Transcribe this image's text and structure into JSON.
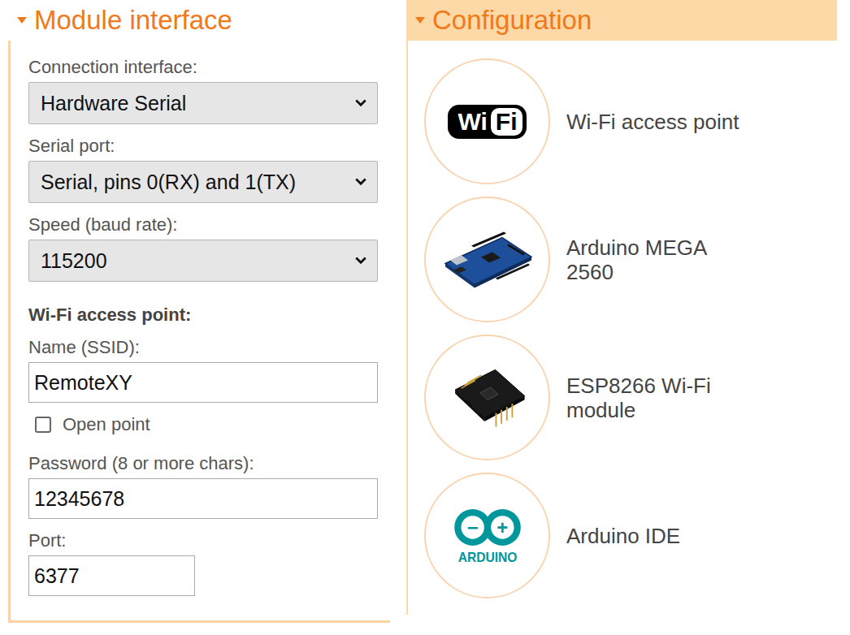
{
  "module_interface": {
    "title": "Module interface",
    "expanded": true,
    "fields": [
      {
        "kind": "select",
        "label": "Connection interface:",
        "value": "Hardware Serial"
      },
      {
        "kind": "select",
        "label": "Serial port:",
        "value": "Serial, pins 0(RX) and 1(TX)"
      },
      {
        "kind": "select",
        "label": "Speed (baud rate):",
        "value": "115200"
      }
    ],
    "wifi_section": {
      "title": "Wi-Fi access point:",
      "fields": [
        {
          "kind": "input",
          "label": "Name (SSID):",
          "value": "RemoteXY",
          "size": "wide"
        },
        {
          "kind": "checkbox",
          "label": "Open point",
          "checked": false
        },
        {
          "kind": "input",
          "label": "Password (8 or more chars):",
          "value": "12345678",
          "size": "wide"
        },
        {
          "kind": "input",
          "label": "Port:",
          "value": "6377",
          "size": "short"
        }
      ]
    }
  },
  "configuration": {
    "title": "Configuration",
    "expanded": true,
    "items": [
      {
        "kind": "wifi",
        "label": "Wi-Fi access point",
        "logo": {
          "left": "Wi",
          "right": "Fi"
        }
      },
      {
        "kind": "board",
        "label": "Arduino MEGA 2560"
      },
      {
        "kind": "module",
        "label": "ESP8266 Wi-Fi module"
      },
      {
        "kind": "ide",
        "label": "Arduino IDE",
        "logo": {
          "minus": "−",
          "plus": "+",
          "text": "ARDUINO"
        }
      }
    ]
  }
}
